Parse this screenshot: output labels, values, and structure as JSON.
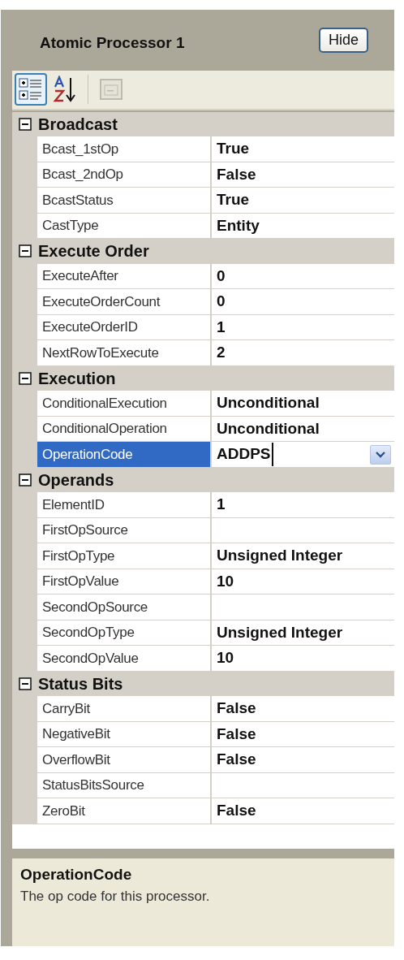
{
  "panel": {
    "title": "Atomic Processor 1",
    "hide_button": "Hide"
  },
  "toolbar": [
    {
      "kind": "categorized",
      "selected": true,
      "disabled": false
    },
    {
      "kind": "alphabetical",
      "selected": false,
      "disabled": false
    },
    {
      "kind": "property-pages",
      "selected": false,
      "disabled": true
    }
  ],
  "categories": [
    {
      "name": "Broadcast",
      "expanded": true,
      "properties": [
        {
          "name": "Bcast_1stOp",
          "value": "True",
          "selected": false
        },
        {
          "name": "Bcast_2ndOp",
          "value": "False",
          "selected": false
        },
        {
          "name": "BcastStatus",
          "value": "True",
          "selected": false
        },
        {
          "name": "CastType",
          "value": "Entity",
          "selected": false
        }
      ]
    },
    {
      "name": "Execute Order",
      "expanded": true,
      "properties": [
        {
          "name": "ExecuteAfter",
          "value": "0",
          "selected": false
        },
        {
          "name": "ExecuteOrderCount",
          "value": "0",
          "selected": false
        },
        {
          "name": "ExecuteOrderID",
          "value": "1",
          "selected": false
        },
        {
          "name": "NextRowToExecute",
          "value": "2",
          "selected": false
        }
      ]
    },
    {
      "name": "Execution",
      "expanded": true,
      "properties": [
        {
          "name": "ConditionalExecution",
          "value": "Unconditional",
          "selected": false
        },
        {
          "name": "ConditionalOperation",
          "value": "Unconditional",
          "selected": false
        },
        {
          "name": "OperationCode",
          "value": "ADDPS",
          "selected": true
        }
      ]
    },
    {
      "name": "Operands",
      "expanded": true,
      "properties": [
        {
          "name": "ElementID",
          "value": "1",
          "selected": false
        },
        {
          "name": "FirstOpSource",
          "selected": false
        },
        {
          "name": "FirstOpType",
          "value": "Unsigned Integer",
          "selected": false
        },
        {
          "name": "FirstOpValue",
          "value": "10",
          "selected": false
        },
        {
          "name": "SecondOpSource",
          "selected": false
        },
        {
          "name": "SecondOpType",
          "value": "Unsigned Integer",
          "selected": false
        },
        {
          "name": "SecondOpValue",
          "value": "10",
          "selected": false
        }
      ]
    },
    {
      "name": "Status Bits",
      "expanded": true,
      "properties": [
        {
          "name": "CarryBit",
          "value": "False",
          "selected": false
        },
        {
          "name": "NegativeBit",
          "value": "False",
          "selected": false
        },
        {
          "name": "OverflowBit",
          "value": "False",
          "selected": false
        },
        {
          "name": "StatusBitsSource",
          "selected": false
        },
        {
          "name": "ZeroBit",
          "value": "False",
          "selected": false
        }
      ]
    }
  ],
  "help": {
    "title": "OperationCode",
    "description": "The op code for this processor."
  }
}
